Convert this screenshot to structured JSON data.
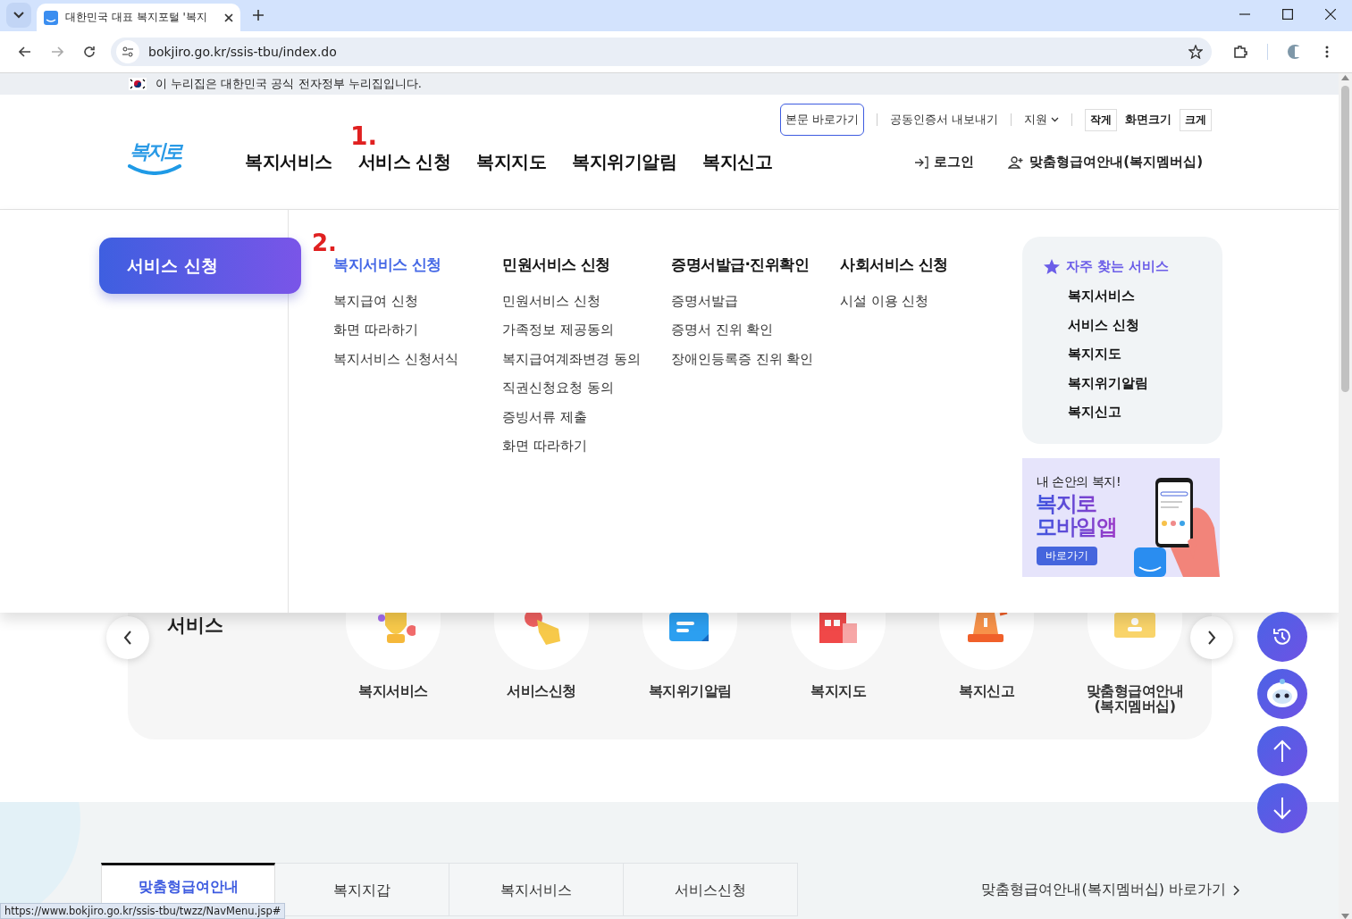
{
  "browser": {
    "tab_title": "대한민국 대표 복지포털 '복지",
    "url": "bokjiro.go.kr/ssis-tbu/index.do"
  },
  "gov_banner": "이 누리집은 대한민국 공식 전자정부 누리집입니다.",
  "utility_links": [
    {
      "label": "본문 바로가기",
      "kind": "outlined"
    },
    {
      "label": "공동인증서 내보내기",
      "kind": "link"
    },
    {
      "label": "지원",
      "kind": "dropdown"
    }
  ],
  "font_size": {
    "smaller": "작게",
    "label": "화면크기",
    "larger": "크게"
  },
  "logo": "복지로",
  "main_nav": [
    "복지서비스",
    "서비스 신청",
    "복지지도",
    "복지위기알림",
    "복지신고"
  ],
  "annotations": [
    "1.",
    "2."
  ],
  "account_links": [
    {
      "label": "로그인",
      "kind": "login"
    },
    {
      "label": "맞춤형급여안내(복지멤버십)",
      "kind": "membership"
    }
  ],
  "mega_menu": {
    "title": "서비스 신청",
    "columns": [
      {
        "heading": "복지서비스 신청",
        "selected": true,
        "items": [
          "복지급여 신청",
          "화면 따라하기",
          "복지서비스 신청서식"
        ]
      },
      {
        "heading": "민원서비스 신청",
        "selected": false,
        "items": [
          "민원서비스 신청",
          "가족정보 제공동의",
          "복지급여계좌변경 동의",
          "직권신청요청 동의",
          "증빙서류 제출",
          "화면 따라하기"
        ]
      },
      {
        "heading": "증명서발급·진위확인",
        "selected": false,
        "items": [
          "증명서발급",
          "증명서 진위 확인",
          "장애인등록증 진위 확인"
        ]
      },
      {
        "heading": "사회서비스 신청",
        "selected": false,
        "items": [
          "시설 이용 신청"
        ]
      }
    ]
  },
  "favorites": {
    "title": "자주 찾는 서비스",
    "items": [
      "복지서비스",
      "서비스 신청",
      "복지지도",
      "복지위기알림",
      "복지신고"
    ]
  },
  "app_banner": {
    "tagline": "내 손안의 복지!",
    "title_lines": [
      "복지로",
      "모바일앱"
    ],
    "button": "바로가기"
  },
  "quick_services": {
    "title": "서비스",
    "items": [
      {
        "label": "복지서비스",
        "kind": "person"
      },
      {
        "label": "서비스신청",
        "kind": "hand"
      },
      {
        "label": "복지위기알림",
        "kind": "note"
      },
      {
        "label": "복지지도",
        "kind": "map"
      },
      {
        "label": "복지신고",
        "kind": "siren"
      },
      {
        "label": "맞춤형급여안내\n(복지멤버십)",
        "kind": "card"
      }
    ]
  },
  "bottom_tabs": [
    {
      "label": "맞춤형급여안내",
      "selected": true
    },
    {
      "label": "복지지갑",
      "selected": false
    },
    {
      "label": "복지서비스",
      "selected": false
    },
    {
      "label": "서비스신청",
      "selected": false
    }
  ],
  "bottom_link": "맞춤형급여안내(복지멤버십) 바로가기",
  "status_url": "https://www.bokjiro.go.kr/ssis-tbu/twzz/NavMenu.jsp#"
}
